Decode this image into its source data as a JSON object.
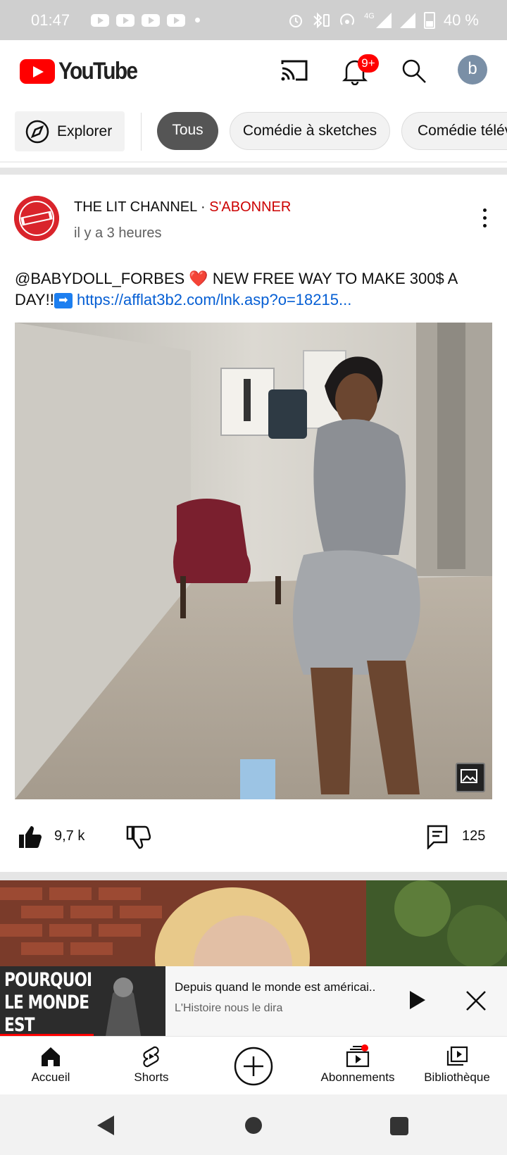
{
  "status_bar": {
    "time": "01:47",
    "battery": "40 %",
    "network": "4G"
  },
  "app": {
    "name": "YouTube",
    "notification_badge": "9+",
    "avatar_letter": "b"
  },
  "chips": {
    "explore": "Explorer",
    "items": [
      "Tous",
      "Comédie à sketches",
      "Comédie télév"
    ]
  },
  "post": {
    "channel": "THE LIT CHANNEL",
    "separator": " · ",
    "subscribe": "S'ABONNER",
    "time_ago": "il y a 3 heures",
    "text_start": "@BABYDOLL_FORBES ",
    "heart": "❤️",
    "text_mid": " NEW FREE WAY TO MAKE 300$ A DAY!!",
    "arrow": "➡",
    "link": "https://afflat3b2.com/lnk.asp?o=18215...",
    "likes": "9,7 k",
    "comments": "125"
  },
  "miniplayer": {
    "thumb_text": "POURQUOI LE MONDE EST AMÉRICAIN",
    "title": "Depuis quand le monde est américai..",
    "channel": "L'Histoire nous le dira",
    "progress": 0.185
  },
  "bottom_nav": {
    "home": "Accueil",
    "shorts": "Shorts",
    "subscriptions": "Abonnements",
    "library": "Bibliothèque"
  },
  "colors": {
    "brand": "#ff0000",
    "link": "#065fd4",
    "subscribe": "#cc0000"
  },
  "icons": [
    "cast-icon",
    "bell-icon",
    "search-icon",
    "compass-icon",
    "more-vert-icon",
    "like-icon",
    "dislike-icon",
    "comment-icon",
    "image-icon",
    "play-icon",
    "close-icon",
    "home-icon",
    "shorts-icon",
    "create-icon",
    "subscriptions-icon",
    "library-icon"
  ]
}
